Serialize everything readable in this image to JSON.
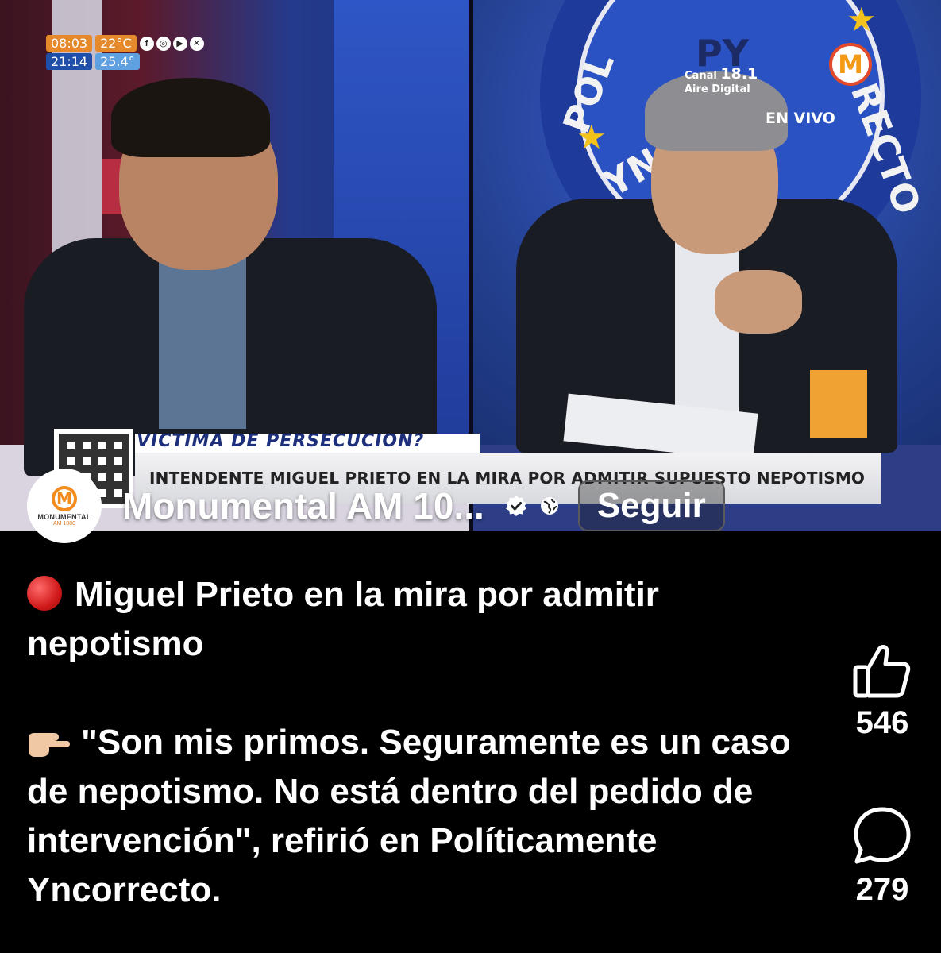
{
  "video": {
    "tv_clock": {
      "time1": "08:03",
      "temp1": "22°C",
      "time2": "21:14",
      "temp2": "25.4°"
    },
    "tv_social_icons": [
      "facebook-icon",
      "instagram-icon",
      "youtube-icon",
      "x-icon"
    ],
    "channel": {
      "prefix": "Canal",
      "number": "18.1",
      "sub": "Aire Digital"
    },
    "live_label": "EN VIVO",
    "tv_logo_letter": "M",
    "badge_letters_left": "POL",
    "badge_letters_top": "PY",
    "badge_letters_right": "RECTO",
    "badge_letters_bottom": "YN",
    "lower_third_top": "VÍCTIMA DE PERSECUCIÓN?",
    "lower_third_main": "INTENDENTE MIGUEL PRIETO EN LA MIRA POR ADMITIR SUPUESTO NEPOTISMO"
  },
  "account": {
    "avatar_letter": "M",
    "avatar_line1": "MONUMENTAL",
    "avatar_line2": "AM 1080",
    "name": "Monumental AM 10...",
    "verified_icon": "verified-badge-icon",
    "privacy_icon": "globe-icon",
    "follow_label": "Seguir"
  },
  "caption": {
    "line1": "Miguel Prieto en la mira por admitir nepotismo",
    "line2": "\"Son mis primos. Seguramente es un caso de nepotismo. No está dentro del pedido de intervención\", refirió en Políticamente Yncorrecto."
  },
  "actions": {
    "likes": "546",
    "comments": "279"
  },
  "colors": {
    "background": "#000000",
    "brand_orange": "#f28c1f",
    "lower_third_blue": "#1d2f7a"
  }
}
